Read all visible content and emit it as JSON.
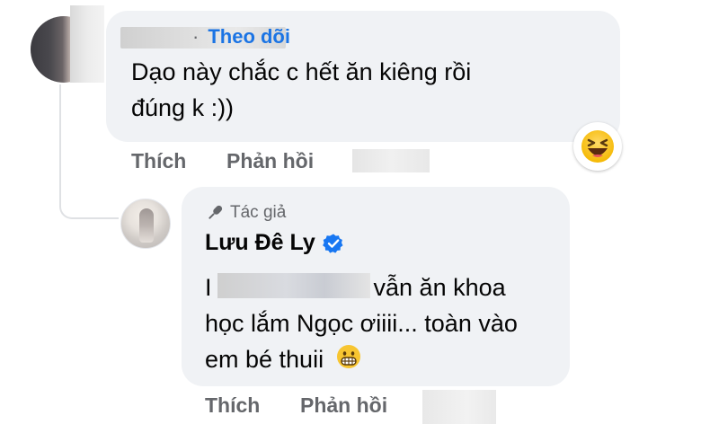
{
  "comment": {
    "follow_label": "Theo dõi",
    "follow_separator": "·",
    "text_line1": "Dạo này chắc c hết ăn kiêng rồi",
    "text_line2": "đúng k :))",
    "like_label": "Thích",
    "reply_label": "Phản hồi",
    "reaction_icon": "haha-reaction-icon"
  },
  "reply": {
    "author_badge": "Tác giả",
    "author_name": "Lưu Đê Ly",
    "verified_icon": "verified-badge-icon",
    "text_line1_prefix": "I",
    "text_line1_suffix": "vẫn ăn khoa",
    "text_line2": "học lắm Ngọc ơiiii... toàn vào",
    "text_line3": "em bé thuii",
    "emoji_icon": "grimacing-emoji-icon",
    "like_label": "Thích",
    "reply_label": "Phản hồi"
  },
  "colors": {
    "bubble": "#f0f2f5",
    "link_blue": "#1b74e4",
    "muted": "#65676b",
    "verified_blue": "#1877f2"
  }
}
